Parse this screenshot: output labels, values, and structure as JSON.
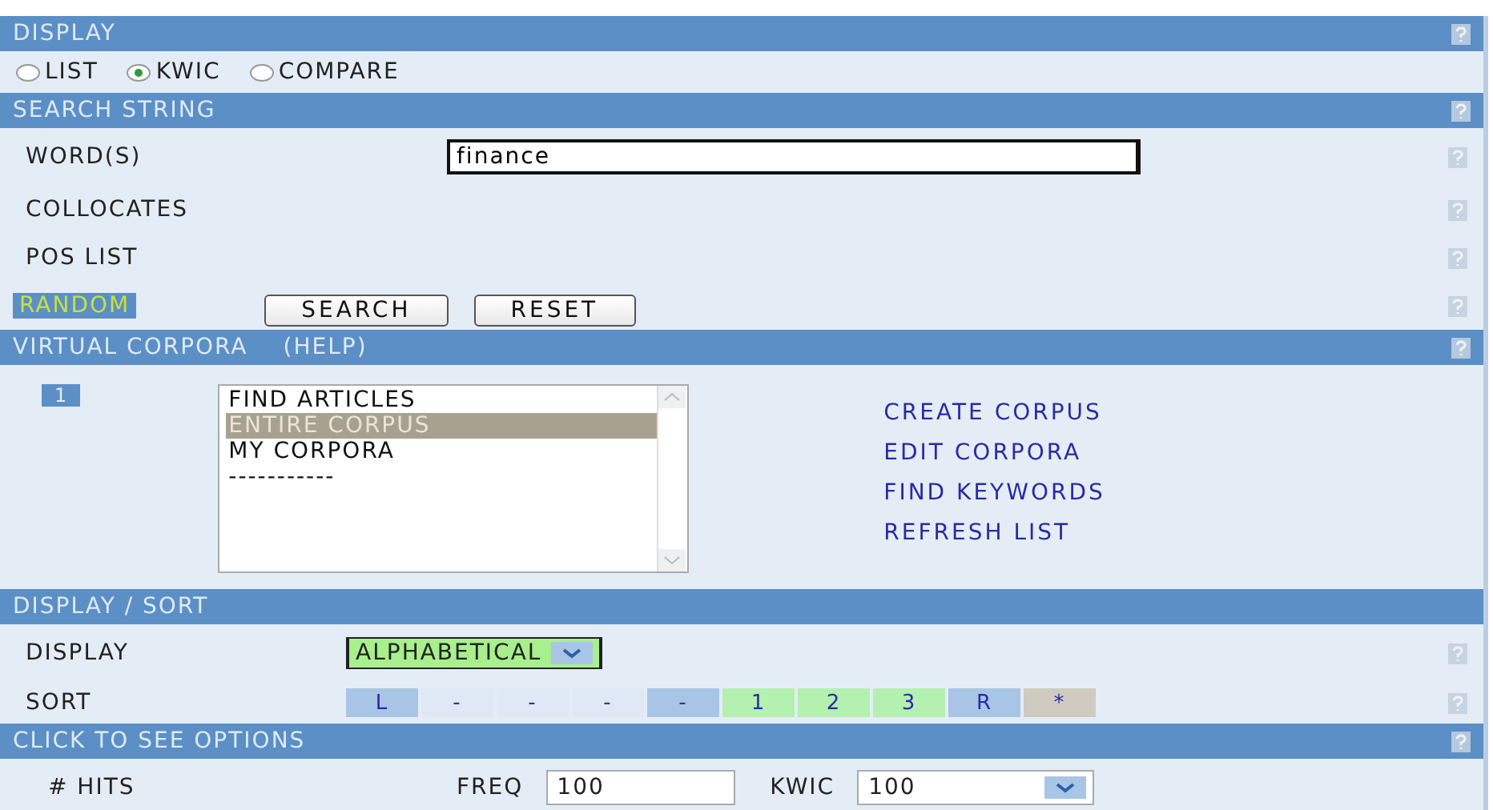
{
  "display": {
    "title": "DISPLAY",
    "help": true,
    "options": [
      {
        "label": "LIST",
        "selected": false
      },
      {
        "label": "KWIC",
        "selected": true
      },
      {
        "label": "COMPARE",
        "selected": false
      }
    ]
  },
  "search": {
    "title": "SEARCH STRING",
    "help": true,
    "rows": [
      {
        "label": "WORD(S)",
        "kind": "input",
        "value": "finance"
      },
      {
        "label": "COLLOCATES",
        "kind": "plain"
      },
      {
        "label": "POS LIST",
        "kind": "plain"
      }
    ],
    "random": "RANDOM",
    "buttons": [
      "SEARCH",
      "RESET"
    ]
  },
  "virtual": {
    "title": "VIRTUAL CORPORA",
    "help_link": "(HELP)",
    "help": true,
    "badge": "1",
    "items": [
      {
        "label": "FIND ARTICLES",
        "selected": false
      },
      {
        "label": "ENTIRE CORPUS",
        "selected": true
      },
      {
        "label": "MY CORPORA",
        "selected": false
      },
      {
        "label": "-----------",
        "selected": false
      }
    ],
    "links": [
      "CREATE CORPUS",
      "EDIT CORPORA",
      "FIND KEYWORDS",
      "REFRESH LIST"
    ]
  },
  "display_sort": {
    "title": "DISPLAY / SORT",
    "help": false,
    "display": {
      "label": "DISPLAY",
      "value": "ALPHABETICAL"
    },
    "sort": {
      "label": "SORT",
      "cells": [
        {
          "label": "L",
          "color": "#a9c5e6"
        },
        {
          "label": "-",
          "color": "#dfe9f5"
        },
        {
          "label": "-",
          "color": "#dfe9f5"
        },
        {
          "label": "-",
          "color": "#dfe9f5"
        },
        {
          "label": "-",
          "color": "#a9c5e6"
        },
        {
          "label": "1",
          "color": "#b4f0b0"
        },
        {
          "label": "2",
          "color": "#b4f0b0"
        },
        {
          "label": "3",
          "color": "#b4f0b0"
        },
        {
          "label": "R",
          "color": "#a9c5e6"
        },
        {
          "label": "*",
          "color": "#cfcbc0"
        }
      ]
    }
  },
  "options": {
    "title": "CLICK TO SEE OPTIONS",
    "help": true,
    "hits": "# HITS",
    "freq": {
      "label": "FREQ",
      "value": "100"
    },
    "kwic": {
      "label": "KWIC",
      "value": "100"
    }
  }
}
